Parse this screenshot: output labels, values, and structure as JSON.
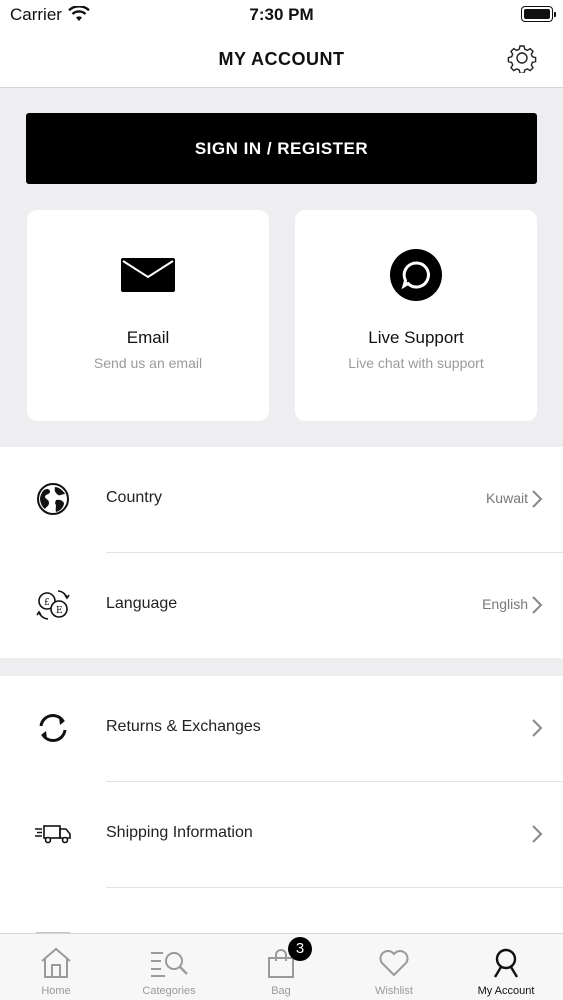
{
  "status_bar": {
    "carrier": "Carrier",
    "time": "7:30 PM"
  },
  "header": {
    "title": "MY ACCOUNT"
  },
  "sign_in": {
    "label": "SIGN IN / REGISTER"
  },
  "contact_cards": [
    {
      "title": "Email",
      "subtitle": "Send us an email",
      "icon": "envelope-icon"
    },
    {
      "title": "Live Support",
      "subtitle": "Live chat with support",
      "icon": "chat-bubble-icon"
    }
  ],
  "settings_rows": [
    {
      "label": "Country",
      "value": "Kuwait",
      "icon": "globe-icon"
    },
    {
      "label": "Language",
      "value": "English",
      "icon": "currency-exchange-icon"
    }
  ],
  "info_rows": [
    {
      "label": "Returns & Exchanges",
      "icon": "return-arrows-icon"
    },
    {
      "label": "Shipping Information",
      "icon": "delivery-truck-icon"
    }
  ],
  "tab_bar": {
    "tabs": [
      {
        "label": "Home",
        "icon": "home-icon"
      },
      {
        "label": "Categories",
        "icon": "categories-search-icon"
      },
      {
        "label": "Bag",
        "icon": "shopping-bag-icon",
        "badge": "3"
      },
      {
        "label": "Wishlist",
        "icon": "heart-icon"
      },
      {
        "label": "My Account",
        "icon": "user-icon",
        "active": true
      }
    ]
  },
  "colors": {
    "background_gray": "#eeedef",
    "primary": "#000000",
    "muted_text": "#9a9a9a"
  }
}
